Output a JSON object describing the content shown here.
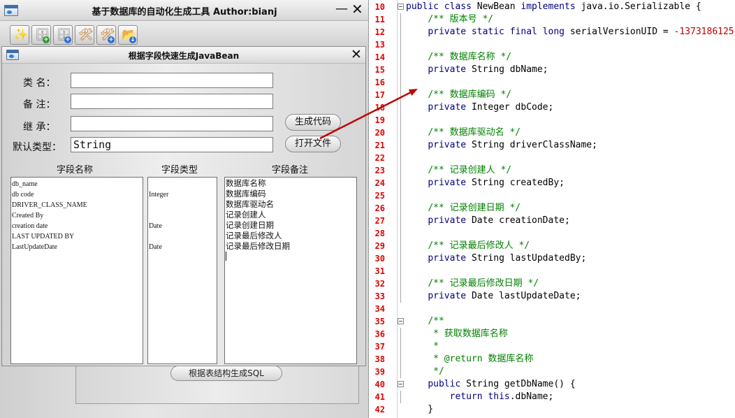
{
  "app": {
    "title": "基于数据库的自动化生成工具 Author:bianj",
    "minimize_glyph": "—",
    "close_glyph": "✕",
    "toolbar": [
      {
        "name": "wand-icon",
        "glyph": "✨",
        "color": "#c87a10",
        "badge": ""
      },
      {
        "name": "database-add-icon",
        "glyph": "🗄",
        "color": "#8a8a8a",
        "badge": "+",
        "badge_color": "#2e9a2e"
      },
      {
        "name": "database-refresh-icon",
        "glyph": "🗄",
        "color": "#8a8a8a",
        "badge": "+",
        "badge_color": "#2f6fd0"
      },
      {
        "name": "tools-icon",
        "glyph": "🛠",
        "color": "#c06a10",
        "badge": ""
      },
      {
        "name": "tools-add-icon",
        "glyph": "🛠",
        "color": "#c06a10",
        "badge": "+",
        "badge_color": "#2f6fd0"
      },
      {
        "name": "folder-download-icon",
        "glyph": "📂",
        "color": "#d8a030",
        "badge": "↓",
        "badge_color": "#2f6fd0"
      }
    ],
    "background_button": "根据表结构生成SQL"
  },
  "dialog": {
    "title": "根据字段快速生成JavaBean",
    "close_glyph": "✕",
    "fields": {
      "class_name": {
        "label": "类   名：",
        "value": ""
      },
      "remark": {
        "label": "备   注：",
        "value": ""
      },
      "extends": {
        "label": "继   承：",
        "value": ""
      },
      "default_type": {
        "label": "默认类型：",
        "value": "String"
      }
    },
    "buttons": {
      "generate": "生成代码",
      "open_file": "打开文件"
    },
    "columns": {
      "name_header": "字段名称",
      "type_header": "字段类型",
      "remark_header": "字段备注"
    },
    "field_names": [
      "db_name",
      "db code",
      "DRIVER_CLASS_NAME",
      "Created By",
      "creation date",
      "LAST UPDATED BY",
      "LastUpdateDate"
    ],
    "field_types": [
      "",
      "Integer",
      "",
      "",
      "Date",
      "",
      "Date"
    ],
    "field_remarks": [
      "数据库名称",
      "数据库编码",
      "数据库驱动名",
      "记录创建人",
      "记录创建日期",
      "记录最后修改人",
      "记录最后修改日期"
    ]
  },
  "editor": {
    "lines": [
      {
        "no": "10",
        "fold": true,
        "parts": [
          [
            "kw",
            "public class "
          ],
          [
            "plain",
            "NewBean "
          ],
          [
            "kw",
            "implements "
          ],
          [
            "plain",
            "java.io.Serializable {"
          ]
        ]
      },
      {
        "no": "11",
        "fold": false,
        "parts": [
          [
            "plain",
            "    "
          ],
          [
            "cm",
            "/** 版本号 */"
          ]
        ]
      },
      {
        "no": "12",
        "fold": false,
        "parts": [
          [
            "plain",
            "    "
          ],
          [
            "kw",
            "private static final long "
          ],
          [
            "plain",
            "serialVersionUID = "
          ],
          [
            "num",
            "-1373186125"
          ]
        ]
      },
      {
        "no": "13",
        "fold": false,
        "parts": []
      },
      {
        "no": "14",
        "fold": false,
        "parts": [
          [
            "plain",
            "    "
          ],
          [
            "cm",
            "/** 数据库名称 */"
          ]
        ]
      },
      {
        "no": "15",
        "fold": false,
        "parts": [
          [
            "plain",
            "    "
          ],
          [
            "kw",
            "private "
          ],
          [
            "plain",
            "String dbName;"
          ]
        ]
      },
      {
        "no": "16",
        "fold": false,
        "parts": []
      },
      {
        "no": "17",
        "fold": false,
        "parts": [
          [
            "plain",
            "    "
          ],
          [
            "cm",
            "/** 数据库编码 */"
          ]
        ]
      },
      {
        "no": "18",
        "fold": false,
        "parts": [
          [
            "plain",
            "    "
          ],
          [
            "kw",
            "private "
          ],
          [
            "plain",
            "Integer dbCode;"
          ]
        ]
      },
      {
        "no": "19",
        "fold": false,
        "parts": []
      },
      {
        "no": "20",
        "fold": false,
        "parts": [
          [
            "plain",
            "    "
          ],
          [
            "cm",
            "/** 数据库驱动名 */"
          ]
        ]
      },
      {
        "no": "21",
        "fold": false,
        "parts": [
          [
            "plain",
            "    "
          ],
          [
            "kw",
            "private "
          ],
          [
            "plain",
            "String driverClassName;"
          ]
        ]
      },
      {
        "no": "22",
        "fold": false,
        "parts": []
      },
      {
        "no": "23",
        "fold": false,
        "parts": [
          [
            "plain",
            "    "
          ],
          [
            "cm",
            "/** 记录创建人 */"
          ]
        ]
      },
      {
        "no": "24",
        "fold": false,
        "parts": [
          [
            "plain",
            "    "
          ],
          [
            "kw",
            "private "
          ],
          [
            "plain",
            "String createdBy;"
          ]
        ]
      },
      {
        "no": "25",
        "fold": false,
        "parts": []
      },
      {
        "no": "26",
        "fold": false,
        "parts": [
          [
            "plain",
            "    "
          ],
          [
            "cm",
            "/** 记录创建日期 */"
          ]
        ]
      },
      {
        "no": "27",
        "fold": false,
        "parts": [
          [
            "plain",
            "    "
          ],
          [
            "kw",
            "private "
          ],
          [
            "plain",
            "Date creationDate;"
          ]
        ]
      },
      {
        "no": "28",
        "fold": false,
        "parts": []
      },
      {
        "no": "29",
        "fold": false,
        "parts": [
          [
            "plain",
            "    "
          ],
          [
            "cm",
            "/** 记录最后修改人 */"
          ]
        ]
      },
      {
        "no": "30",
        "fold": false,
        "parts": [
          [
            "plain",
            "    "
          ],
          [
            "kw",
            "private "
          ],
          [
            "plain",
            "String lastUpdatedBy;"
          ]
        ]
      },
      {
        "no": "31",
        "fold": false,
        "parts": []
      },
      {
        "no": "32",
        "fold": false,
        "parts": [
          [
            "plain",
            "    "
          ],
          [
            "cm",
            "/** 记录最后修改日期 */"
          ]
        ]
      },
      {
        "no": "33",
        "fold": false,
        "parts": [
          [
            "plain",
            "    "
          ],
          [
            "kw",
            "private "
          ],
          [
            "plain",
            "Date lastUpdateDate;"
          ]
        ]
      },
      {
        "no": "34",
        "fold": false,
        "parts": []
      },
      {
        "no": "35",
        "fold": true,
        "parts": [
          [
            "plain",
            "    "
          ],
          [
            "cm",
            "/**"
          ]
        ]
      },
      {
        "no": "36",
        "fold": false,
        "parts": [
          [
            "plain",
            "     "
          ],
          [
            "cm",
            "* 获取数据库名称"
          ]
        ]
      },
      {
        "no": "37",
        "fold": false,
        "parts": [
          [
            "plain",
            "     "
          ],
          [
            "cm",
            "*"
          ]
        ]
      },
      {
        "no": "38",
        "fold": false,
        "parts": [
          [
            "plain",
            "     "
          ],
          [
            "cm",
            "* @return 数据库名称"
          ]
        ]
      },
      {
        "no": "39",
        "fold": false,
        "parts": [
          [
            "plain",
            "     "
          ],
          [
            "cm",
            "*/"
          ]
        ]
      },
      {
        "no": "40",
        "fold": true,
        "parts": [
          [
            "plain",
            "    "
          ],
          [
            "kw",
            "public "
          ],
          [
            "plain",
            "String getDbName() {"
          ]
        ]
      },
      {
        "no": "41",
        "fold": false,
        "parts": [
          [
            "plain",
            "        "
          ],
          [
            "kw",
            "return this"
          ],
          [
            "plain",
            ".dbName;"
          ]
        ]
      },
      {
        "no": "42",
        "fold": false,
        "parts": [
          [
            "plain",
            "    }"
          ]
        ]
      }
    ],
    "colors": {
      "keyword": "#00007f",
      "comment": "#008000",
      "number": "#c00000",
      "line_number": "#e00000"
    }
  },
  "annotation_arrow_color": "#c00000"
}
